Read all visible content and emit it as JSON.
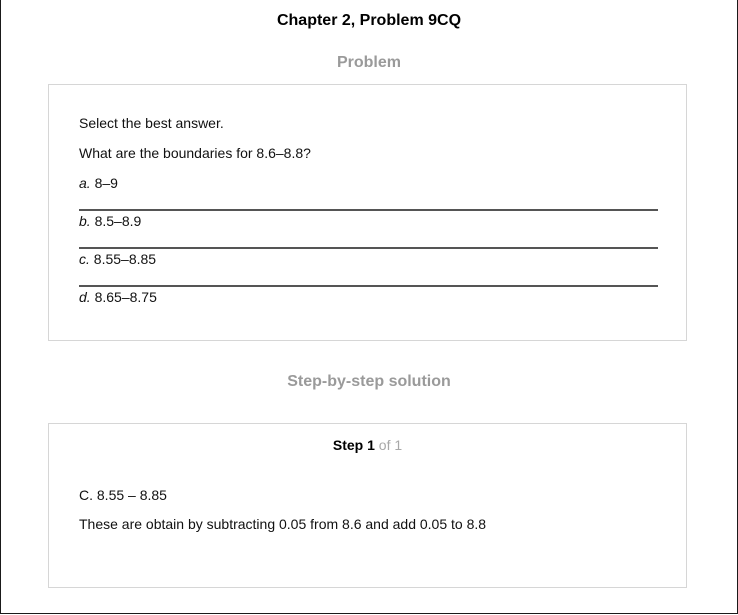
{
  "page": {
    "title": "Chapter 2, Problem 9CQ"
  },
  "problem": {
    "heading": "Problem",
    "instruction": "Select the best answer.",
    "question": "What are the boundaries for 8.6–8.8?",
    "options": [
      {
        "letter": "a.",
        "text": "8–9"
      },
      {
        "letter": "b.",
        "text": "8.5–8.9"
      },
      {
        "letter": "c.",
        "text": "8.55–8.85"
      },
      {
        "letter": "d.",
        "text": "8.65–8.75"
      }
    ]
  },
  "solution": {
    "heading": "Step-by-step solution",
    "step_word": "Step",
    "step_number": "1",
    "step_of": "of 1",
    "answer": "C. 8.55 – 8.85",
    "explanation": "These are obtain by subtracting 0.05 from 8.6 and add 0.05 to 8.8"
  }
}
